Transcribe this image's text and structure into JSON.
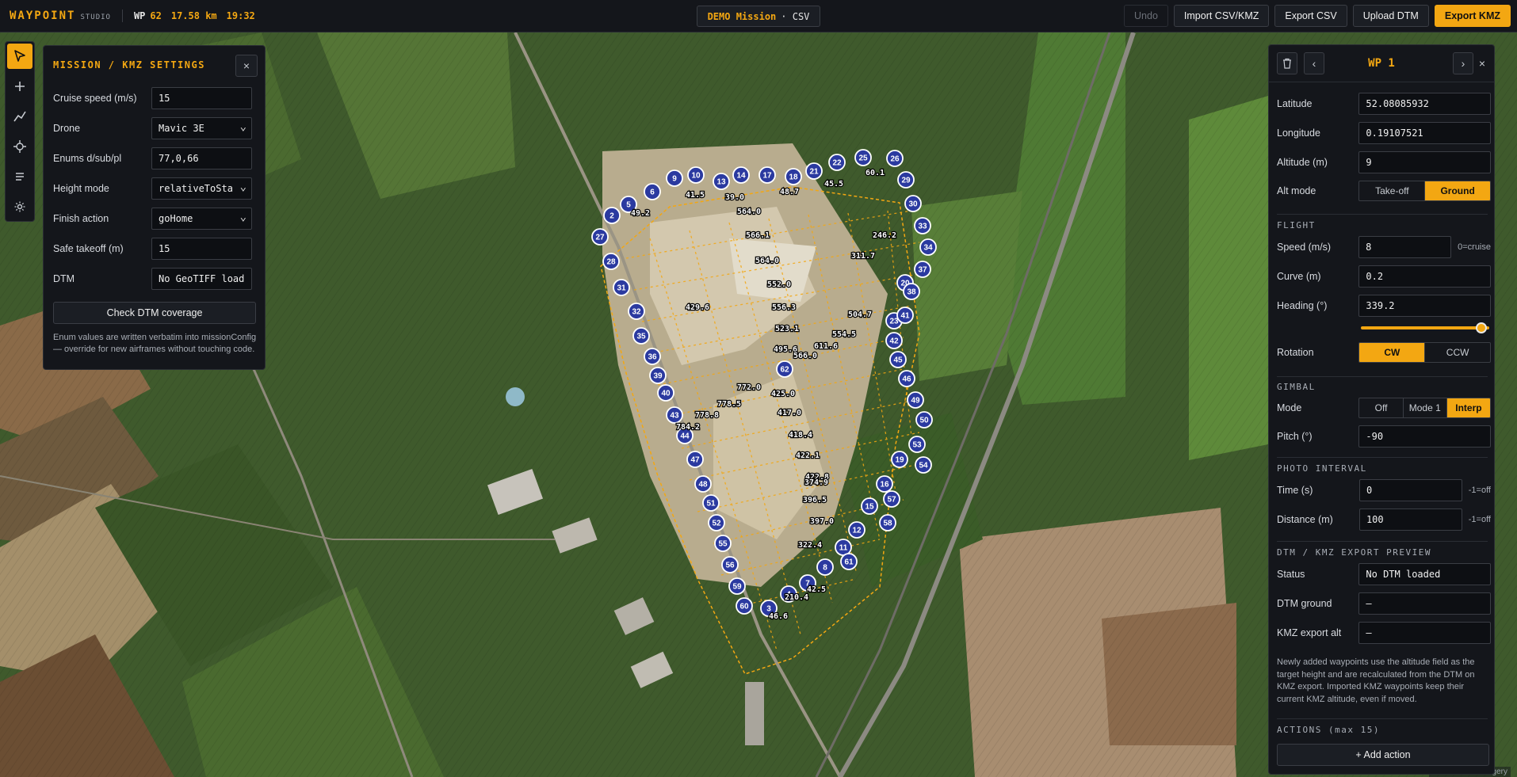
{
  "topbar": {
    "brand": "WAYPOINT",
    "brand_sub": "STUDIO",
    "wp_label": "WP",
    "wp_count": "62",
    "distance": "17.58 km",
    "duration": "19:32",
    "mission_name": "DEMO Mission",
    "mission_source": "· CSV",
    "buttons": {
      "undo": "Undo",
      "import": "Import CSV/KMZ",
      "export_csv": "Export CSV",
      "upload_dtm": "Upload DTM",
      "export_kmz": "Export KMZ"
    }
  },
  "toolbar": {
    "tools": [
      "select-tool",
      "add-waypoint-tool",
      "draw-path-tool",
      "poi-tool",
      "list-tool",
      "settings-tool"
    ]
  },
  "settings": {
    "title": "MISSION / KMZ SETTINGS",
    "close": "×",
    "rows": [
      {
        "label": "Cruise speed (m/s)",
        "value": "15"
      },
      {
        "label": "Drone",
        "value": "Mavic 3E"
      },
      {
        "label": "Enums d/sub/pl",
        "value": "77,0,66"
      },
      {
        "label": "Height mode",
        "value": "relativeToSta"
      },
      {
        "label": "Finish action",
        "value": "goHome"
      },
      {
        "label": "Safe takeoff (m)",
        "value": "15"
      },
      {
        "label": "DTM",
        "value": "No GeoTIFF load"
      }
    ],
    "check_button": "Check DTM coverage",
    "note": "Enum values are written verbatim into missionConfig — override for new airframes without touching code."
  },
  "waypoint": {
    "title": "WP 1",
    "prev": "‹",
    "next": "›",
    "close": "×",
    "position": {
      "latitude_label": "Latitude",
      "latitude": "52.08085932",
      "longitude_label": "Longitude",
      "longitude": "0.19107521",
      "altitude_label": "Altitude (m)",
      "altitude": "9",
      "alt_mode_label": "Alt mode",
      "alt_mode_options": [
        "Take-off",
        "Ground"
      ],
      "alt_mode_selected": "Ground"
    },
    "flight": {
      "section": "FLIGHT",
      "speed_label": "Speed (m/s)",
      "speed": "8",
      "speed_suffix": "0=cruise",
      "curve_label": "Curve (m)",
      "curve": "0.2",
      "heading_label": "Heading (°)",
      "heading": "339.2",
      "heading_slider_fraction": 0.94,
      "rotation_label": "Rotation",
      "rotation_options": [
        "CW",
        "CCW"
      ],
      "rotation_selected": "CW"
    },
    "gimbal": {
      "section": "GIMBAL",
      "mode_label": "Mode",
      "mode_options": [
        "Off",
        "Mode 1",
        "Interp"
      ],
      "mode_selected": "Interp",
      "pitch_label": "Pitch (°)",
      "pitch": "-90"
    },
    "photo": {
      "section": "PHOTO INTERVAL",
      "time_label": "Time (s)",
      "time": "0",
      "time_suffix": "-1=off",
      "distance_label": "Distance (m)",
      "distance": "100",
      "distance_suffix": "-1=off"
    },
    "dtm": {
      "section": "DTM / KMZ EXPORT PREVIEW",
      "status_label": "Status",
      "status": "No DTM loaded",
      "ground_label": "DTM ground",
      "ground": "–",
      "kmz_alt_label": "KMZ export alt",
      "kmz_alt": "–",
      "note": "Newly added waypoints use the altitude field as the target height and are recalculated from the DTM on KMZ export. Imported KMZ waypoints keep their current KMZ altitude, even if moved."
    },
    "actions": {
      "section": "ACTIONS (max 15)",
      "add": "+ Add action"
    }
  },
  "map": {
    "colors": {
      "marker": "#2b3aa0",
      "path": "#f3a712",
      "accent": "#f3a712"
    },
    "attribution": "© Esri World Imagery",
    "markers": [
      {
        "n": "2"
      },
      {
        "n": "3"
      },
      {
        "n": "4"
      },
      {
        "n": "5"
      },
      {
        "n": "6"
      },
      {
        "n": "7"
      },
      {
        "n": "8"
      },
      {
        "n": "9"
      },
      {
        "n": "10"
      },
      {
        "n": "11"
      },
      {
        "n": "12"
      },
      {
        "n": "13"
      },
      {
        "n": "14"
      },
      {
        "n": "15"
      },
      {
        "n": "16"
      },
      {
        "n": "17"
      },
      {
        "n": "18"
      },
      {
        "n": "19"
      },
      {
        "n": "20"
      },
      {
        "n": "21"
      },
      {
        "n": "22"
      },
      {
        "n": "23"
      },
      {
        "n": "25"
      },
      {
        "n": "26"
      },
      {
        "n": "27"
      },
      {
        "n": "28"
      },
      {
        "n": "29"
      },
      {
        "n": "30"
      },
      {
        "n": "31"
      },
      {
        "n": "32"
      },
      {
        "n": "33"
      },
      {
        "n": "34"
      },
      {
        "n": "35"
      },
      {
        "n": "36"
      },
      {
        "n": "37"
      },
      {
        "n": "38"
      },
      {
        "n": "39"
      },
      {
        "n": "40"
      },
      {
        "n": "41"
      },
      {
        "n": "42"
      },
      {
        "n": "43"
      },
      {
        "n": "44"
      },
      {
        "n": "45"
      },
      {
        "n": "46"
      },
      {
        "n": "47"
      },
      {
        "n": "48"
      },
      {
        "n": "49"
      },
      {
        "n": "50"
      },
      {
        "n": "51"
      },
      {
        "n": "52"
      },
      {
        "n": "53"
      },
      {
        "n": "54"
      },
      {
        "n": "55"
      },
      {
        "n": "56"
      },
      {
        "n": "57"
      },
      {
        "n": "58"
      },
      {
        "n": "59"
      },
      {
        "n": "60"
      },
      {
        "n": "61"
      },
      {
        "n": "62"
      }
    ],
    "altitude_labels": [
      "41.5",
      "39.0",
      "48.7",
      "45.5",
      "60.1",
      "49.2",
      "564.0",
      "566.1",
      "246.2",
      "564.0",
      "311.7",
      "552.0",
      "429.6",
      "556.3",
      "504.7",
      "554.5",
      "523.1",
      "611.6",
      "495.6",
      "566.0",
      "772.0",
      "425.0",
      "778.5",
      "417.0",
      "778.8",
      "784.2",
      "418.4",
      "422.1",
      "422.8",
      "374.9",
      "396.5",
      "397.0",
      "322.4",
      "210.4",
      "42.5",
      "46.6"
    ]
  }
}
